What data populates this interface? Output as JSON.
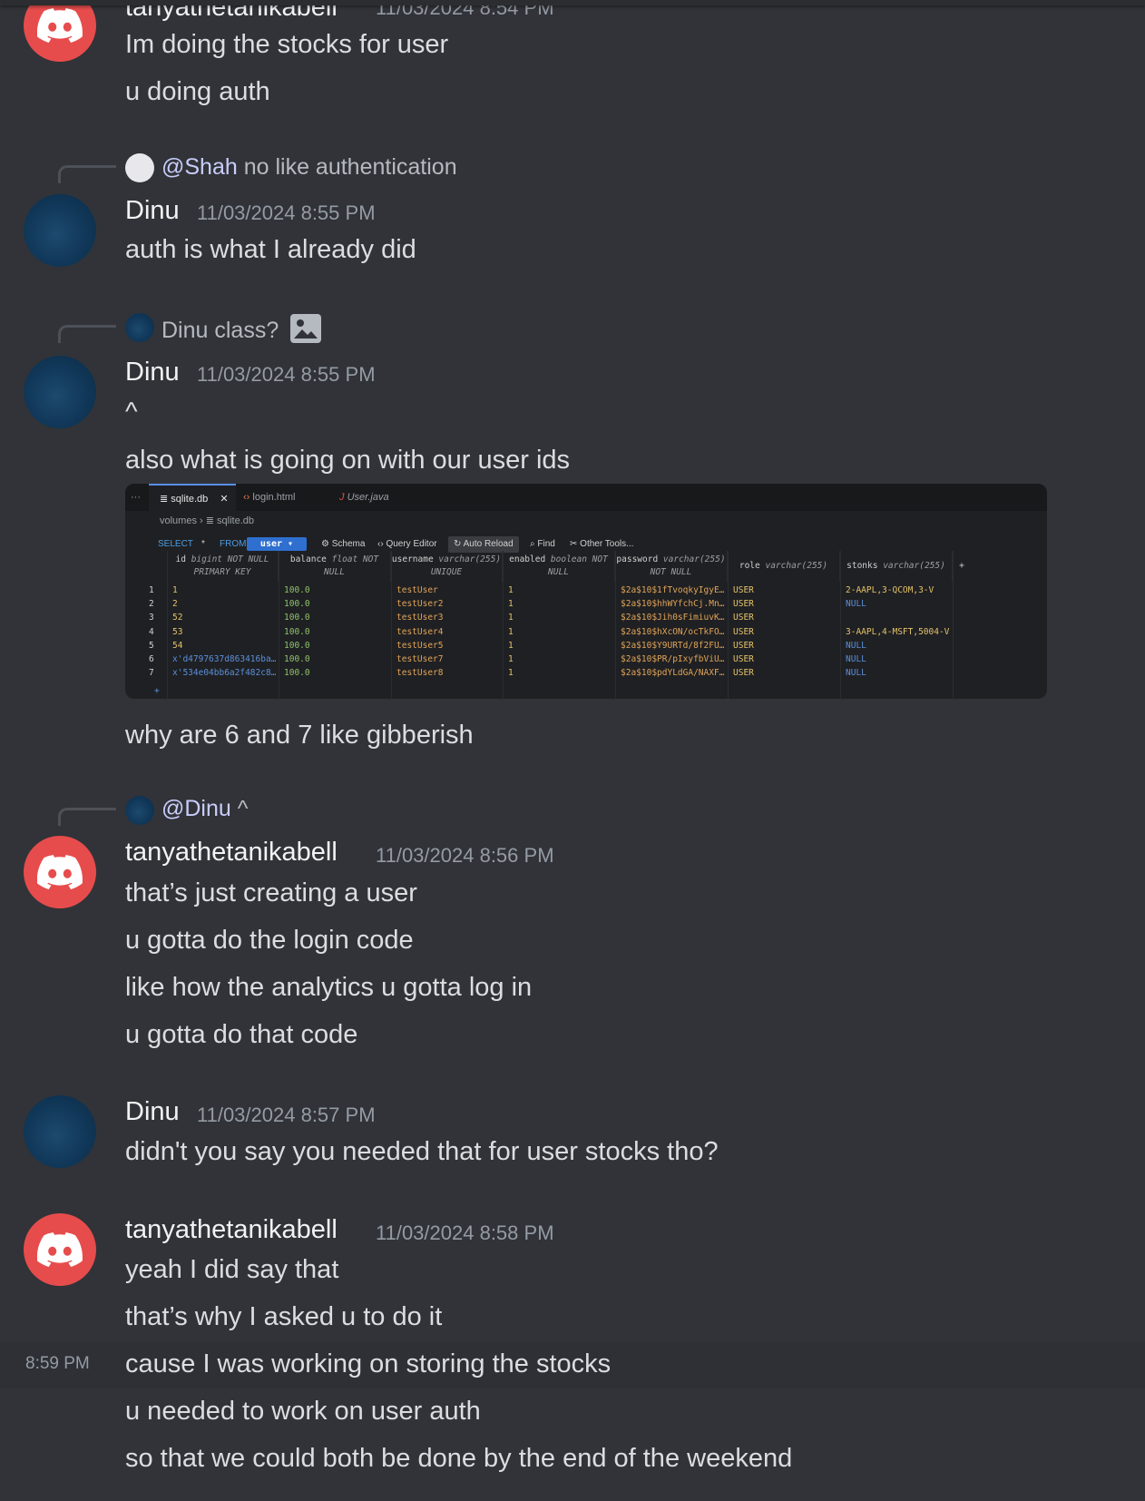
{
  "colors": {
    "background": "#313338",
    "discord_avatar": "#e74c4c",
    "muted": "#949ba4",
    "text": "#dbdee1"
  },
  "messages": {
    "m0": {
      "author": "tanyathetanikabell",
      "timestamp": "11/03/2024 8:54 PM",
      "lines": [
        "Im doing the stocks for user",
        "u doing auth"
      ]
    },
    "m1": {
      "reply_author": "@Shah",
      "reply_text": "no like authentication",
      "author": "Dinu",
      "timestamp": "11/03/2024 8:55 PM",
      "lines": [
        "auth is what I already did"
      ]
    },
    "m2": {
      "reply_author": "Dinu",
      "reply_text": "class?",
      "reply_icon": "image-icon",
      "author": "Dinu",
      "timestamp": "11/03/2024 8:55 PM",
      "lines": [
        "^",
        "also what is going on with our user ids",
        "why are 6 and 7 like gibberish"
      ]
    },
    "m3": {
      "reply_author": "@Dinu",
      "reply_text": "^",
      "author": "tanyathetanikabell",
      "timestamp": "11/03/2024 8:56 PM",
      "lines": [
        "that’s just creating a user",
        "u gotta do the login code",
        "like how the analytics u gotta log in",
        "u gotta do that code"
      ]
    },
    "m4": {
      "author": "Dinu",
      "timestamp": "11/03/2024 8:57 PM",
      "lines": [
        "didn't you say you needed that for user stocks tho?"
      ]
    },
    "m5": {
      "author": "tanyathetanikabell",
      "timestamp": "11/03/2024 8:58 PM",
      "hover_time": "8:59 PM",
      "lines": [
        "yeah I did say that",
        "that’s why I asked u to do it",
        "cause I was working on storing the stocks",
        "u needed to work on user auth",
        "so that we could both be done by the end of the weekend"
      ]
    }
  },
  "attachment": {
    "tabs": [
      "sqlite.db",
      "login.html",
      "User.java"
    ],
    "breadcrumb": [
      "volumes",
      "sqlite.db"
    ],
    "toolbar": {
      "select": "SELECT",
      "star": "*",
      "from": "FROM",
      "table": "user",
      "schema": "Schema",
      "query_editor": "Query Editor",
      "auto_reload": "Auto Reload",
      "find": "Find",
      "other_tools": "Other Tools..."
    },
    "columns": [
      {
        "name": "id",
        "type": "bigint NOT NULL",
        "extra": "PRIMARY KEY"
      },
      {
        "name": "balance",
        "type": "float NOT",
        "extra": "NULL"
      },
      {
        "name": "username",
        "type": "varchar(255)",
        "extra": "UNIQUE"
      },
      {
        "name": "enabled",
        "type": "boolean NOT",
        "extra": "NULL"
      },
      {
        "name": "password",
        "type": "varchar(255)",
        "extra": "NOT NULL"
      },
      {
        "name": "role",
        "type": "varchar(255)",
        "extra": ""
      },
      {
        "name": "stonks",
        "type": "varchar(255)",
        "extra": ""
      }
    ],
    "rows": [
      [
        "1",
        "1",
        "100.0",
        "testUser",
        "1",
        "$2a$10$1fTvoqkyIgyE…",
        "USER",
        "2-AAPL,3-QCOM,3-V"
      ],
      [
        "2",
        "2",
        "100.0",
        "testUser2",
        "1",
        "$2a$10$hhWYfchCj.Mn…",
        "USER",
        "NULL"
      ],
      [
        "3",
        "52",
        "100.0",
        "testUser3",
        "1",
        "$2a$10$Jih0sFimiuvK…",
        "USER",
        ""
      ],
      [
        "4",
        "53",
        "100.0",
        "testUser4",
        "1",
        "$2a$10$hXcON/ocTkFO…",
        "USER",
        "3-AAPL,4-MSFT,5004-V"
      ],
      [
        "5",
        "54",
        "100.0",
        "testUser5",
        "1",
        "$2a$10$Y9URTd/8f2FU…",
        "USER",
        "NULL"
      ],
      [
        "6",
        "x'd4797637d863416ba…",
        "100.0",
        "testUser7",
        "1",
        "$2a$10$PR/pIxyfbViU…",
        "USER",
        "NULL"
      ],
      [
        "7",
        "x'534e04bb6a2f482c8…",
        "100.0",
        "testUser8",
        "1",
        "$2a$10$pdYLdGA/NAXF…",
        "USER",
        "NULL"
      ]
    ],
    "add_row": "+"
  }
}
